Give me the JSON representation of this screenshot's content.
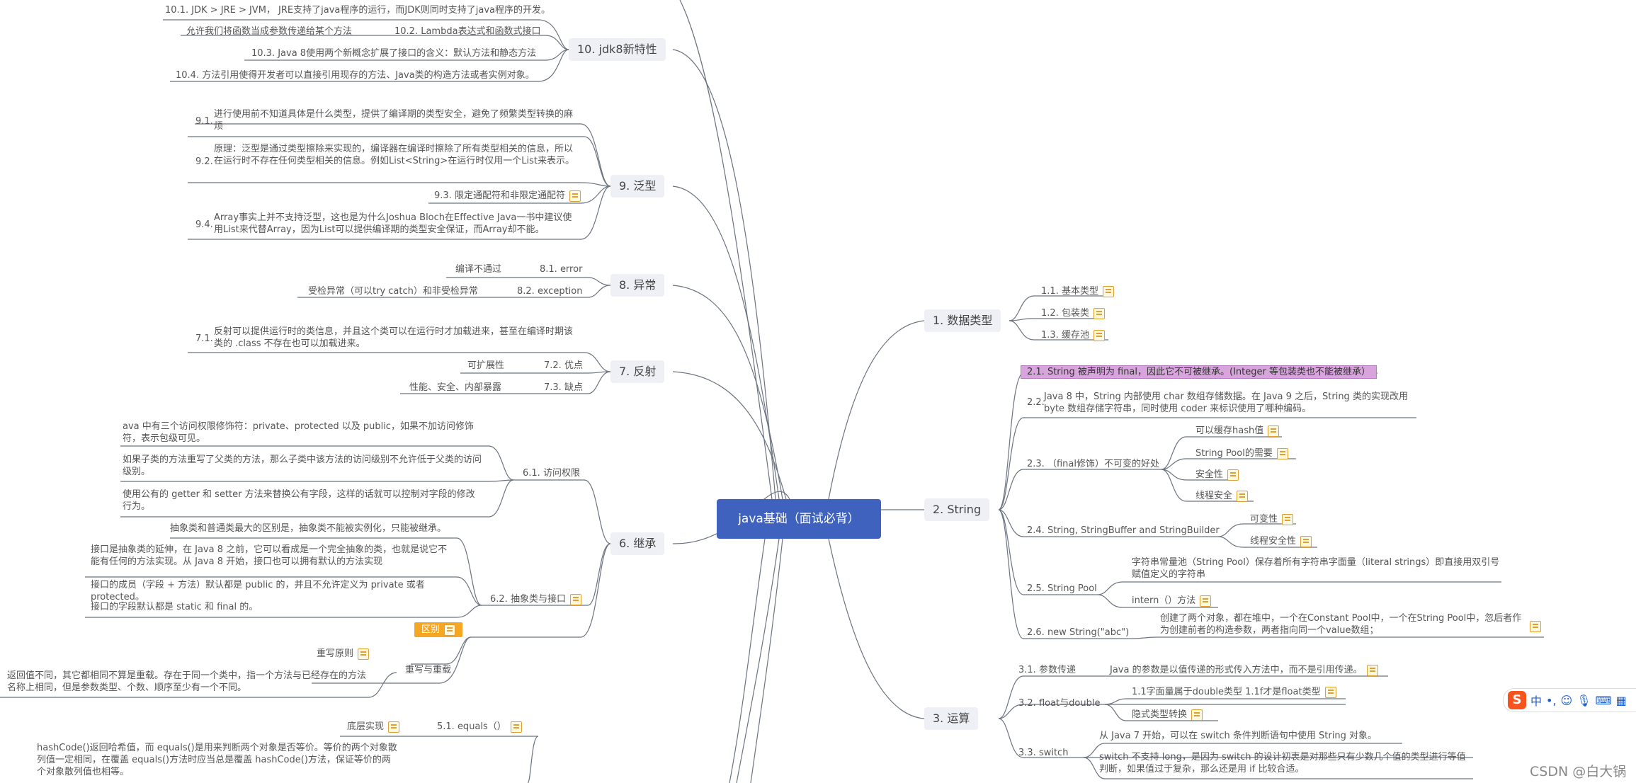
{
  "root": "java基础（面试必背）",
  "topics": {
    "t10": "10. jdk8新特性",
    "t9": "9. 泛型",
    "t8": "8. 异常",
    "t7": "7. 反射",
    "t6": "6. 继承",
    "t1": "1. 数据类型",
    "t2": "2. String",
    "t3": "3. 运算"
  },
  "left": {
    "n10_1": "10.1. JDK > JRE > JVM， JRE支持了java程序的运行，而JDK则同时支持了java程序的开发。",
    "n10_2_desc": "允许我们将函数当成参数传递给某个方法",
    "n10_2": "10.2. Lambda表达式和函数式接口",
    "n10_3": "10.3. Java 8使用两个新概念扩展了接口的含义：默认方法和静态方法",
    "n10_4": "10.4. 方法引用使得开发者可以直接引用现存的方法、Java类的构造方法或者实例对象。",
    "n9_1_num": "9.1.",
    "n9_1": "进行使用前不知道具体是什么类型，提供了编译期的类型安全，避免了频繁类型转换的麻烦",
    "n9_2_num": "9.2.",
    "n9_2": "原理：泛型是通过类型擦除来实现的，编译器在编译时擦除了所有类型相关的信息，所以在运行时不存在任何类型相关的信息。例如List<String>在运行时仅用一个List来表示。",
    "n9_3": "9.3. 限定通配符和非限定通配符",
    "n9_4_num": "9.4.",
    "n9_4": "Array事实上并不支持泛型，这也是为什么Joshua Bloch在Effective Java一书中建议使用List来代替Array，因为List可以提供编译期的类型安全保证，而Array却不能。",
    "n8_1_desc": "编译不通过",
    "n8_1": "8.1. error",
    "n8_2_desc": "受检异常（可以try catch）和非受检异常",
    "n8_2": "8.2. exception",
    "n7_1_num": "7.1.",
    "n7_1": "反射可以提供运行时的类信息，并且这个类可以在运行时才加载进来，甚至在编译时期该类的 .class 不存在也可以加载进来。",
    "n7_2_desc": "可扩展性",
    "n7_2": "7.2. 优点",
    "n7_3_desc": "性能、安全、内部暴露",
    "n7_3": "7.3. 缺点",
    "n6_1a": "ava 中有三个访问权限修饰符：private、protected 以及 public，如果不加访问修饰符，表示包级可见。",
    "n6_1b": "如果子类的方法重写了父类的方法，那么子类中该方法的访问级别不允许低于父类的访问级别。",
    "n6_1c": "使用公有的 getter 和 setter 方法来替换公有字段，这样的话就可以控制对字段的修改行为。",
    "n6_1": "6.1. 访问权限",
    "n6_2a": "抽象类和普通类最大的区别是，抽象类不能被实例化，只能被继承。",
    "n6_2b": "接口是抽象类的延伸，在 Java 8 之前，它可以看成是一个完全抽象的类，也就是说它不能有任何的方法实现。从 Java 8 开始，接口也可以拥有默认的方法实现",
    "n6_2c": "接口的成员（字段 + 方法）默认都是 public 的，并且不允许定义为 private 或者 protected。",
    "n6_2d": "接口的字段默认都是 static 和 final 的。",
    "n6_2": "6.2. 抽象类与接口",
    "n6_diff": "区别",
    "n6_rule": "重写原则",
    "n6_overload_desc": "返回值不同，其它都相同不算是重载。存在于同一个类中，指一个方法与已经存在的方法名称上相同，但是参数类型、个数、顺序至少有一个不同。",
    "n6_overload": "重写与重载",
    "n5_impl": "底层实现",
    "n5_1": "5.1. equals（）",
    "n5_hash": "hashCode()返回哈希值，而 equals()是用来判断两个对象是否等价。等价的两个对象散列值一定相同，在覆盖 equals()方法时应当总是覆盖 hashCode()方法，保证等价的两个对象散列值也相等。"
  },
  "right": {
    "n1_1": "1.1. 基本类型",
    "n1_2": "1.2. 包装类",
    "n1_3": "1.3. 缓存池",
    "n2_1": "2.1. String 被声明为 final，因此它不可被继承。(Integer 等包装类也不能被继承）",
    "n2_2_num": "2.2.",
    "n2_2": "Java 8 中，String 内部使用 char 数组存储数据。在 Java 9 之后，String 类的实现改用 byte 数组存储字符串，同时使用 coder 来标识使用了哪种编码。",
    "n2_3": "2.3. （final修饰）不可变的好处",
    "n2_3a": "可以缓存hash值",
    "n2_3b": "String Pool的需要",
    "n2_3c": "安全性",
    "n2_3d": "线程安全",
    "n2_4": "2.4. String, StringBuffer and StringBuilder",
    "n2_4a": "可变性",
    "n2_4b": "线程安全性",
    "n2_5": "2.5. String Pool",
    "n2_5a": "字符串常量池（String Pool）保存着所有字符串字面量（literal strings）即直接用双引号赋值定义的字符串",
    "n2_5b": "intern（）方法",
    "n2_6": "2.6. new String(\"abc\")",
    "n2_6a": "创建了两个对象，都在堆中，一个在Constant Pool中，一个在String Pool中，忽后者作为创建前者的构造参数，两者指向同一个value数组；",
    "n3_1": "3.1. 参数传递",
    "n3_1a": "Java 的参数是以值传递的形式传入方法中，而不是引用传递。",
    "n3_2": "3.2. float与double",
    "n3_2a": "1.1字面量属于double类型 1.1f才是float类型",
    "n3_2b": "隐式类型转换",
    "n3_3": "3.3. switch",
    "n3_3a": "从 Java 7 开始，可以在 switch 条件判断语句中使用 String 对象。",
    "n3_3b": "switch 不支持 long，是因为 switch 的设计初衷是对那些只有少数几个值的类型进行等值判断，如果值过于复杂，那么还是用 if 比较合适。"
  },
  "ime": {
    "lang": "中",
    "punct": "•,"
  },
  "watermark": "CSDN @白大锅"
}
